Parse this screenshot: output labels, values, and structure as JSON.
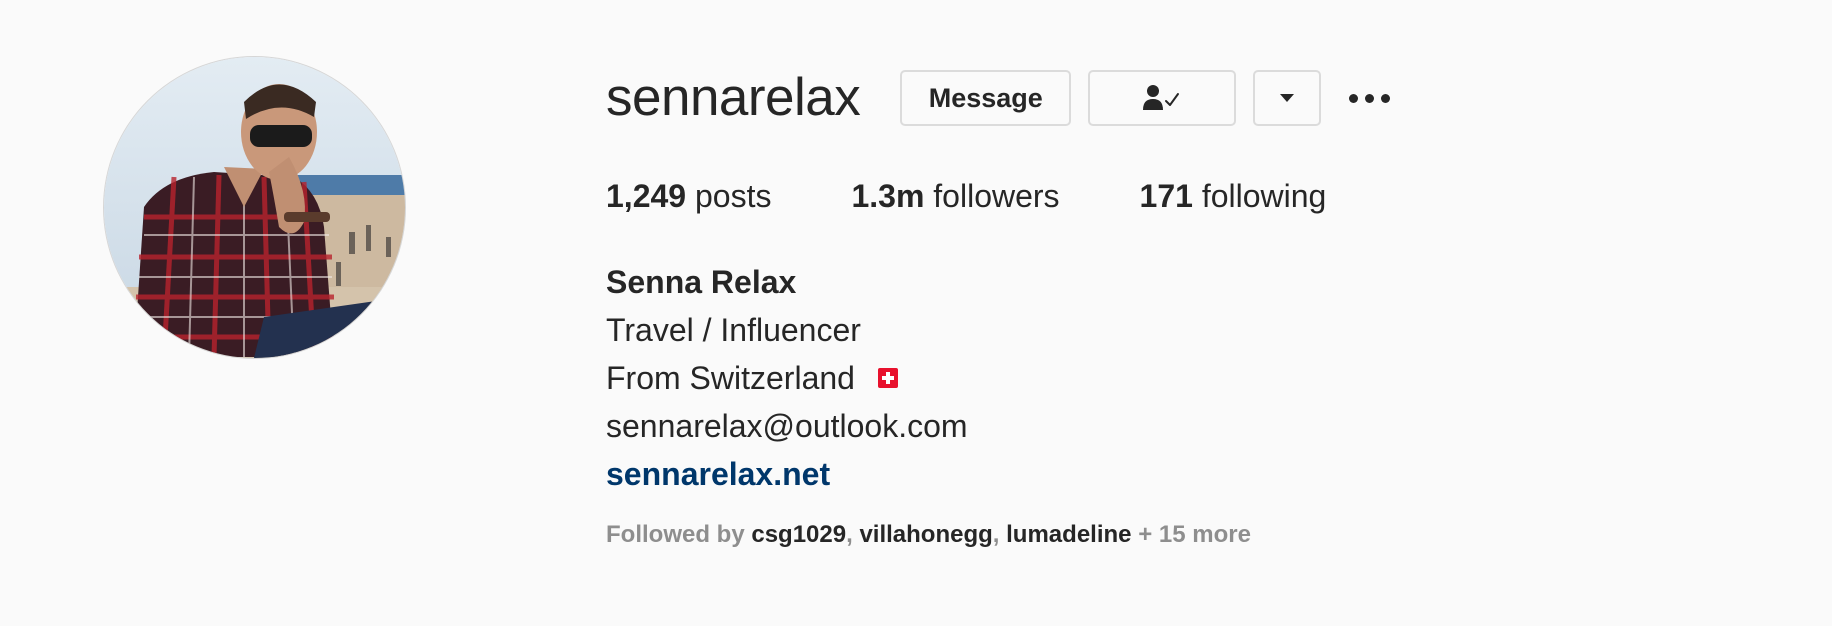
{
  "profile": {
    "username": "sennarelax",
    "avatar_alt": "sennarelax profile picture"
  },
  "actions": {
    "message_label": "Message",
    "following_icon": "person-check-icon",
    "dropdown_icon": "caret-down-icon",
    "more_icon": "more-options-icon"
  },
  "stats": {
    "posts_count": "1,249",
    "posts_label": "posts",
    "followers_count": "1.3m",
    "followers_label": "followers",
    "following_count": "171",
    "following_label": "following"
  },
  "bio": {
    "full_name": "Senna Relax",
    "line1": "Travel / Influencer",
    "line2": "From Switzerland",
    "line2_flag": "switzerland-flag",
    "email": "sennarelax@outlook.com",
    "website": "sennarelax.net"
  },
  "followed_by": {
    "prefix": "Followed by",
    "users": [
      "csg1029",
      "villahonegg",
      "lumadeline"
    ],
    "separator": ",",
    "more": "+ 15 more"
  },
  "colors": {
    "background": "#fafafa",
    "text": "#262626",
    "muted": "#8e8e8e",
    "link": "#00376b",
    "border": "#dbdbdb",
    "flag_red": "#e8112d"
  }
}
